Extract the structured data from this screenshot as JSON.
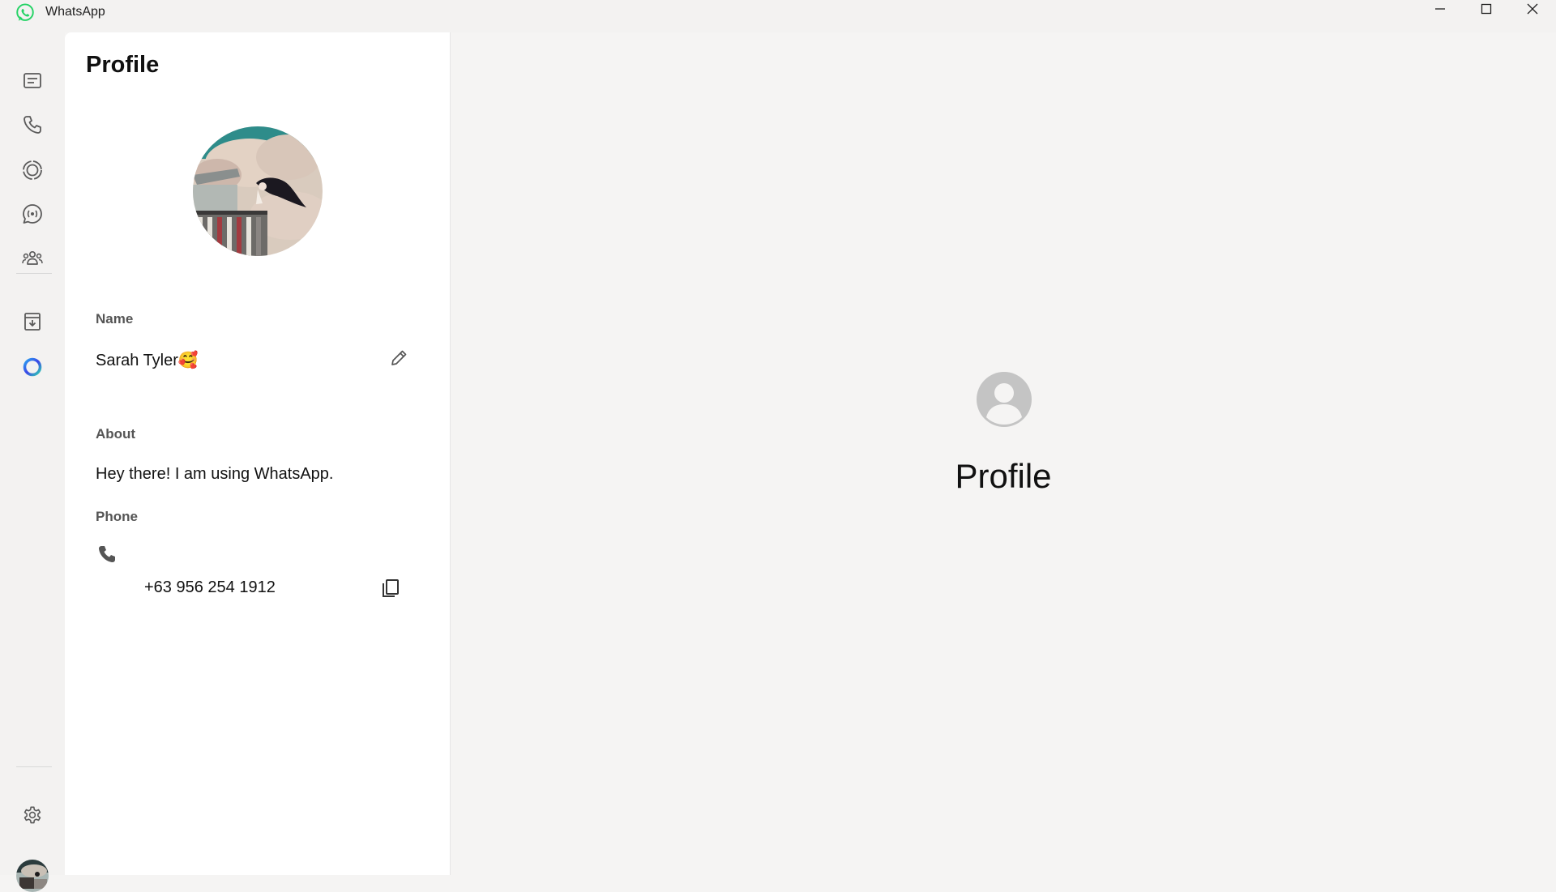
{
  "window": {
    "title": "WhatsApp",
    "controls": {
      "minimize_icon": "minimize-icon",
      "maximize_icon": "maximize-icon",
      "close_icon": "close-icon"
    }
  },
  "rail": {
    "items": [
      {
        "name": "chats",
        "icon": "chat-icon"
      },
      {
        "name": "calls",
        "icon": "phone-icon"
      },
      {
        "name": "status",
        "icon": "status-icon"
      },
      {
        "name": "channels",
        "icon": "channels-icon"
      },
      {
        "name": "communities",
        "icon": "communities-icon"
      },
      {
        "name": "archived",
        "icon": "archive-icon"
      },
      {
        "name": "meta-ai",
        "icon": "meta-ai-icon"
      }
    ],
    "bottom": [
      {
        "name": "settings",
        "icon": "gear-icon"
      },
      {
        "name": "profile",
        "icon": "avatar"
      }
    ]
  },
  "profile_panel": {
    "title": "Profile",
    "name_label": "Name",
    "name_value": "Sarah Tyler🥰",
    "about_label": "About",
    "about_value": "Hey there! I am using WhatsApp.",
    "phone_label": "Phone",
    "phone_value": "+63 956 254 1912"
  },
  "main": {
    "title": "Profile",
    "icon": "profile-placeholder-icon"
  },
  "colors": {
    "brand": "#25D366",
    "accent_ring": "#3d7bf2",
    "icon_gray": "#5a5a5a"
  }
}
